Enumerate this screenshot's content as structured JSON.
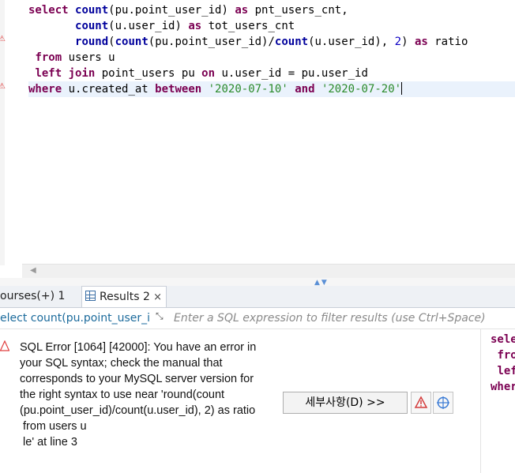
{
  "editor": {
    "lines": [
      [
        {
          "t": "select",
          "c": "kw"
        },
        {
          "t": " "
        },
        {
          "t": "count",
          "c": "fn"
        },
        {
          "t": "(pu.point_user_id) "
        },
        {
          "t": "as",
          "c": "kw"
        },
        {
          "t": " pnt_users_cnt,"
        }
      ],
      [
        {
          "t": "       "
        },
        {
          "t": "count",
          "c": "fn"
        },
        {
          "t": "(u.user_id) "
        },
        {
          "t": "as",
          "c": "kw"
        },
        {
          "t": " tot_users_cnt"
        }
      ],
      [
        {
          "t": "       "
        },
        {
          "t": "round",
          "c": "fn"
        },
        {
          "t": "("
        },
        {
          "t": "count",
          "c": "fn"
        },
        {
          "t": "(pu.point_user_id)/"
        },
        {
          "t": "count",
          "c": "fn"
        },
        {
          "t": "(u.user_id), "
        },
        {
          "t": "2",
          "c": "num"
        },
        {
          "t": ") "
        },
        {
          "t": "as",
          "c": "kw"
        },
        {
          "t": " ratio"
        }
      ],
      [
        {
          "t": " "
        },
        {
          "t": "from",
          "c": "kw"
        },
        {
          "t": " users u"
        }
      ],
      [
        {
          "t": " "
        },
        {
          "t": "left",
          "c": "kw"
        },
        {
          "t": " "
        },
        {
          "t": "join",
          "c": "kw"
        },
        {
          "t": " point_users pu "
        },
        {
          "t": "on",
          "c": "kw"
        },
        {
          "t": " u.user_id = pu.user_id"
        }
      ],
      [
        {
          "t": "where",
          "c": "kw"
        },
        {
          "t": " u.created_at "
        },
        {
          "t": "between",
          "c": "kw"
        },
        {
          "t": " "
        },
        {
          "t": "'2020-07-10'",
          "c": "str"
        },
        {
          "t": " "
        },
        {
          "t": "and",
          "c": "kw"
        },
        {
          "t": " "
        },
        {
          "t": "'2020-07-20'",
          "c": "str"
        }
      ]
    ]
  },
  "tabs": [
    {
      "label": "ourses(+) 1"
    },
    {
      "label": "Results 2",
      "close": "×"
    }
  ],
  "filter": {
    "query": "elect count(pu.point_user_id",
    "placeholder": "Enter a SQL expression to filter results (use Ctrl+Space)"
  },
  "error": {
    "message": "SQL Error [1064] [42000]: You have an error in\nyour SQL syntax; check the manual that\ncorresponds to your MySQL server version for\nthe right syntax to use near 'round(count\n(pu.point_user_id)/count(u.user_id), 2) as ratio\n from users u\n le' at line 3",
    "details_label": "세부사항(D) >>"
  },
  "side_preview": {
    "lines": [
      [
        {
          "t": "sele",
          "c": "kw"
        }
      ],
      [
        {
          "t": ""
        }
      ],
      [
        {
          "t": ""
        }
      ],
      [
        {
          "t": " "
        },
        {
          "t": "fro",
          "c": "kw"
        }
      ],
      [
        {
          "t": " "
        },
        {
          "t": "lef",
          "c": "kw"
        }
      ],
      [
        {
          "t": "wher",
          "c": "kw"
        }
      ]
    ]
  },
  "colors": {
    "keyword": "#7b0052",
    "function": "#00009c",
    "string": "#2a8a2a",
    "error": "#e04040",
    "accent": "#3a6ea5"
  }
}
